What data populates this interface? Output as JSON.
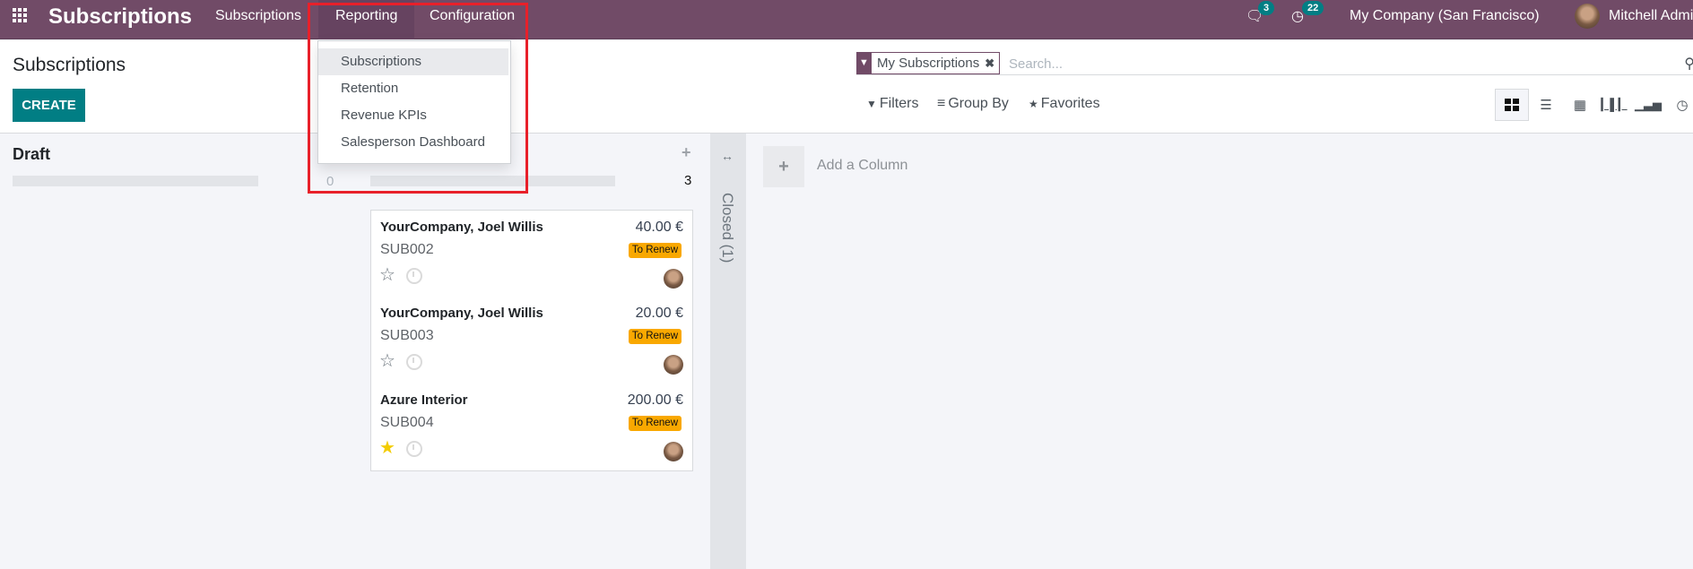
{
  "navbar": {
    "app_name": "Subscriptions",
    "menu": [
      {
        "label": "Subscriptions"
      },
      {
        "label": "Reporting",
        "active": true
      },
      {
        "label": "Configuration"
      }
    ],
    "messages_badge": "3",
    "activities_badge": "22",
    "company": "My Company (San Francisco)",
    "user": "Mitchell Admin"
  },
  "reporting_menu": {
    "items": [
      {
        "label": "Subscriptions",
        "hovered": true
      },
      {
        "label": "Retention"
      },
      {
        "label": "Revenue KPIs"
      },
      {
        "label": "Salesperson Dashboard"
      }
    ]
  },
  "control_panel": {
    "title": "Subscriptions",
    "create_label": "CREATE",
    "facet": {
      "label": "My Subscriptions",
      "icon": "filter-icon"
    },
    "search_placeholder": "Search...",
    "filters_label": "Filters",
    "groupby_label": "Group By",
    "favorites_label": "Favorites",
    "views": [
      "kanban",
      "list",
      "pivot",
      "graph",
      "cohort",
      "activity"
    ],
    "active_view": "kanban"
  },
  "kanban": {
    "columns": [
      {
        "title": "Draft",
        "count": "0",
        "cards": []
      },
      {
        "title": "",
        "count": "3",
        "cards": [
          {
            "name": "YourCompany, Joel Willis",
            "code": "SUB002",
            "price": "40.00 €",
            "tag": "To Renew",
            "starred": false
          },
          {
            "name": "YourCompany, Joel Willis",
            "code": "SUB003",
            "price": "20.00 €",
            "tag": "To Renew",
            "starred": false
          },
          {
            "name": "Azure Interior",
            "code": "SUB004",
            "price": "200.00 €",
            "tag": "To Renew",
            "starred": true
          }
        ]
      }
    ],
    "folded_column": {
      "label": "Closed (1)"
    },
    "add_column_label": "Add a Column"
  },
  "colors": {
    "brand": "#714b67",
    "primary": "#017e84",
    "tag": "#f9a800",
    "highlight": "#e8202a"
  }
}
